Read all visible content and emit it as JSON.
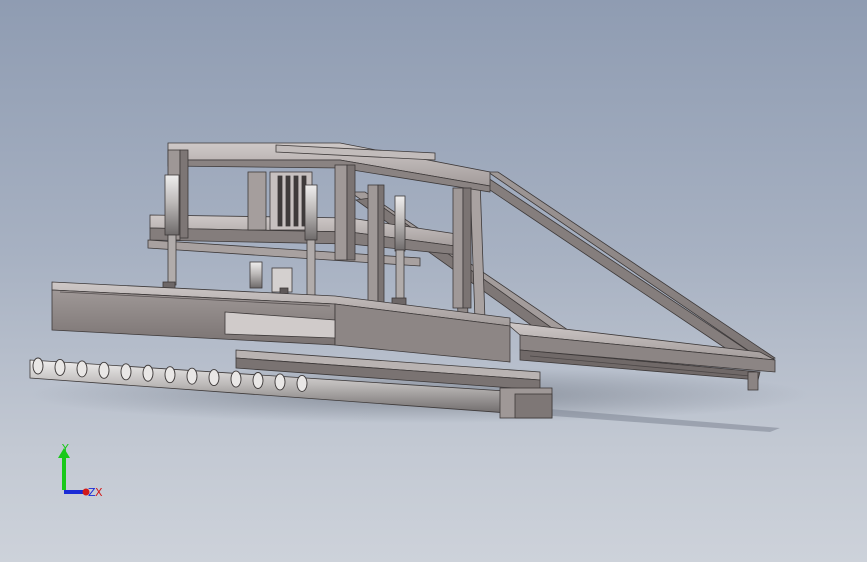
{
  "triad": {
    "y_label": "Y",
    "z_label": "Z",
    "x_label": "X",
    "y_color": "#19c919",
    "z_color": "#1a2bd6",
    "x_color": "#d21a1a"
  },
  "colors": {
    "background_top": "#8f9cb2",
    "background_bottom": "#cdd2da",
    "metal_light": "#b7b1b0",
    "metal_mid": "#9a9291",
    "metal_dark": "#6f6868",
    "edge": "#3d3939"
  }
}
